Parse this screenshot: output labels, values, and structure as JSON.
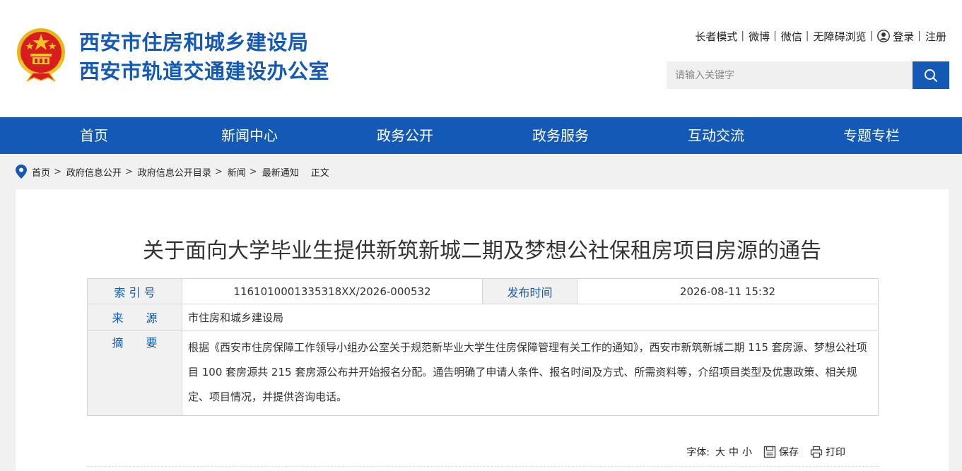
{
  "header": {
    "site_name_line1": "西安市住房和城乡建设局",
    "site_name_line2": "西安市轨道交通建设办公室",
    "top_links": {
      "elder_mode": "长者模式",
      "weibo": "微博",
      "wechat": "微信",
      "accessibility": "无障碍浏览",
      "login": "登录",
      "register": "注册",
      "separator": "|"
    },
    "search": {
      "placeholder": "请输入关键字",
      "value": ""
    }
  },
  "nav": {
    "items": [
      {
        "label": "首页"
      },
      {
        "label": "新闻中心"
      },
      {
        "label": "政务公开"
      },
      {
        "label": "政务服务"
      },
      {
        "label": "互动交流"
      },
      {
        "label": "专题专栏"
      }
    ]
  },
  "breadcrumb": {
    "items": [
      "首页",
      "政府信息公开",
      "政府信息公开目录",
      "新闻",
      "最新通知"
    ],
    "arrow": ">",
    "current": "正文"
  },
  "article": {
    "title": "关于面向大学毕业生提供新筑新城二期及梦想公社保租房项目房源的通告",
    "meta": {
      "index_label": "索 引 号",
      "index_value": "1161010001335318XX/2026-000532",
      "publish_label": "发布时间",
      "publish_value": "2026-08-11 15:32",
      "source_label": "来　　源",
      "source_value": "市住房和城乡建设局",
      "abstract_label": "摘　　要",
      "abstract_value": "根据《西安市住房保障工作领导小组办公室关于规范新毕业大学生住房保障管理有关工作的通知》，西安市新筑新城二期 115 套房源、梦想公社项目 100 套房源共 215 套房源公布并开始报名分配。通告明确了申请人条件、报名时间及方式、所需资料等，介绍项目类型及优惠政策、相关规定、项目情况，并提供咨询电话。"
    },
    "tools": {
      "font_label": "字体:",
      "font_large": "大",
      "font_medium": "中",
      "font_small": "小",
      "save": "保存",
      "print": "打印"
    }
  },
  "colors": {
    "brand_blue": "#1359b5",
    "emblem_red": "#d71d1d",
    "emblem_gold": "#f3c522"
  },
  "icons": [
    "national-emblem-icon",
    "user-icon",
    "search-icon",
    "location-pin-icon",
    "save-icon",
    "print-icon"
  ]
}
